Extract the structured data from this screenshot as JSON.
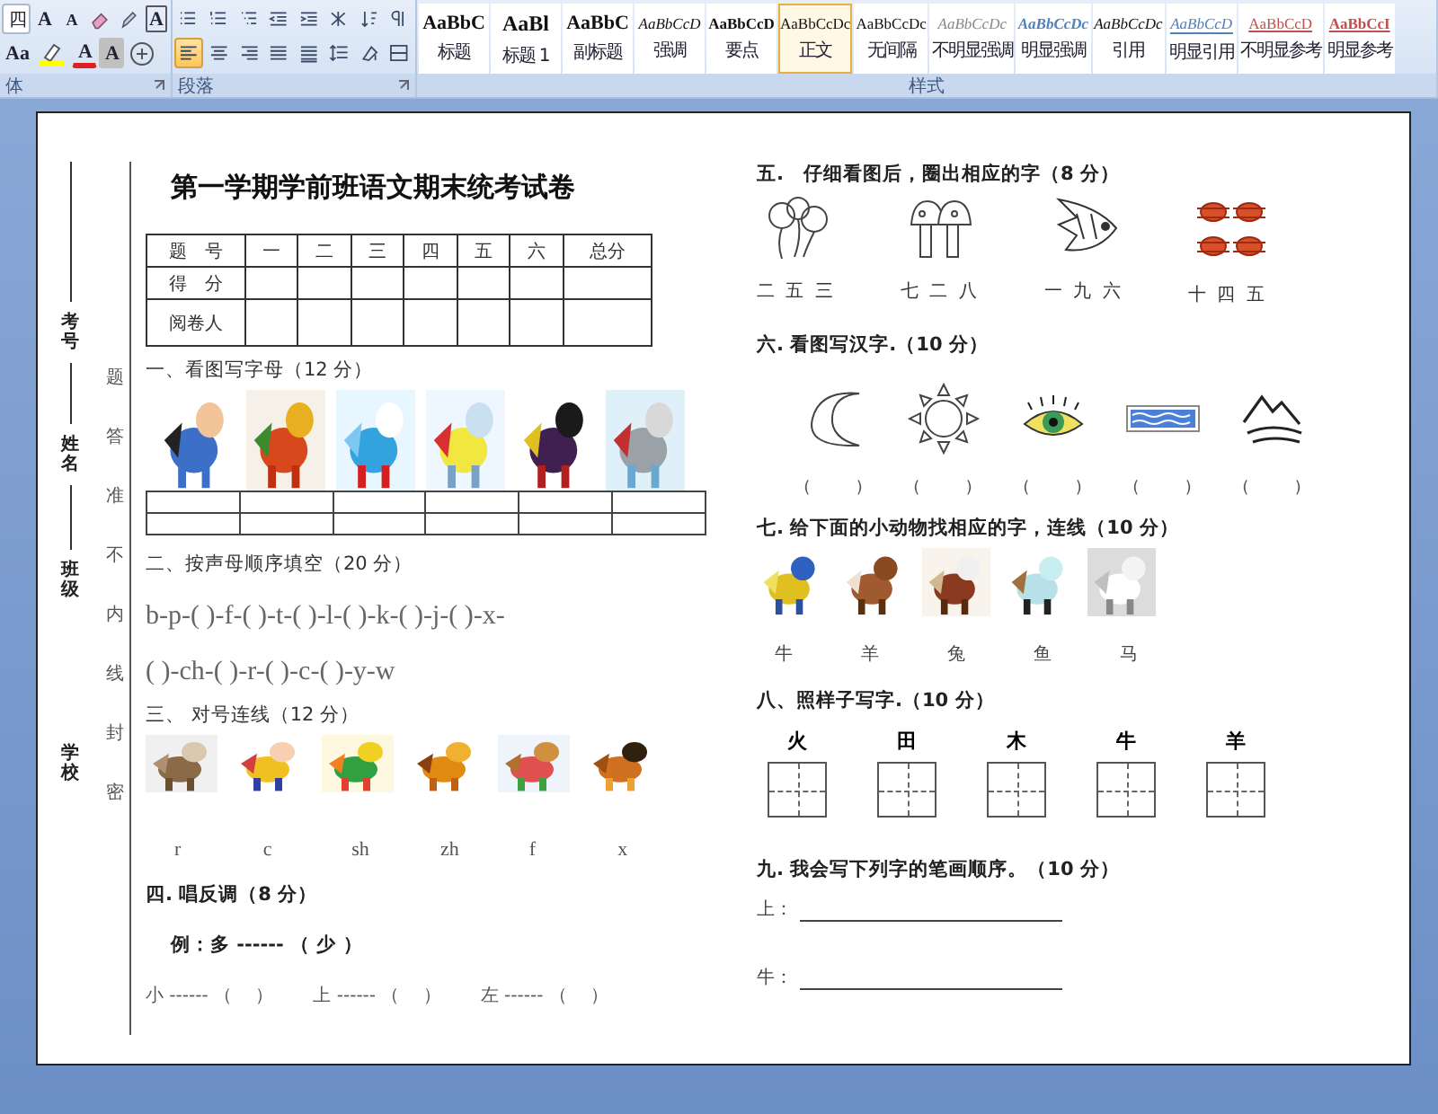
{
  "ribbon": {
    "font_group": {
      "label": "体",
      "top_tools": [
        {
          "kind": "size_field",
          "label": "四"
        },
        {
          "kind": "grow",
          "label": "A"
        },
        {
          "kind": "shrink",
          "label": "A"
        },
        {
          "kind": "clear"
        },
        {
          "kind": "phonetic"
        },
        {
          "kind": "border_char",
          "label": "A"
        }
      ],
      "bottom_tools": [
        {
          "kind": "case",
          "label": "Aa"
        },
        {
          "kind": "highlight"
        },
        {
          "kind": "font_color",
          "label": "A"
        },
        {
          "kind": "shading_char",
          "label": "A"
        },
        {
          "kind": "enclose"
        }
      ]
    },
    "paragraph_group": {
      "label": "段落",
      "top_tools": [
        {
          "kind": "bullets"
        },
        {
          "kind": "numbering"
        },
        {
          "kind": "multilevel"
        },
        {
          "kind": "outdent"
        },
        {
          "kind": "indent"
        },
        {
          "kind": "asian_layout"
        },
        {
          "kind": "sort"
        },
        {
          "kind": "marks"
        }
      ],
      "alignments": [
        {
          "kind": "left",
          "selected": true
        },
        {
          "kind": "center",
          "selected": false
        },
        {
          "kind": "right",
          "selected": false
        },
        {
          "kind": "justify",
          "selected": false
        },
        {
          "kind": "distributed",
          "selected": false
        }
      ],
      "bottom_tools": [
        {
          "kind": "line_spacing"
        },
        {
          "kind": "shading"
        },
        {
          "kind": "borders"
        }
      ]
    },
    "styles_group": {
      "label": "样式",
      "styles": [
        {
          "sample": "AaBbC",
          "name": "标题",
          "kind": "title",
          "selected": false
        },
        {
          "sample": "AaBl",
          "name": "标题 1",
          "kind": "heading",
          "selected": false
        },
        {
          "sample": "AaBbC",
          "name": "副标题",
          "kind": "title",
          "selected": false
        },
        {
          "sample": "AaBbCcD",
          "name": "强调",
          "kind": "emphasis",
          "selected": false
        },
        {
          "sample": "AaBbCcD",
          "name": "要点",
          "kind": "strong",
          "selected": false
        },
        {
          "sample": "AaBbCcDc",
          "name": "正文",
          "kind": "normal",
          "selected": true
        },
        {
          "sample": "AaBbCcDc",
          "name": "无间隔",
          "kind": "normal",
          "selected": false
        },
        {
          "sample": "AaBbCcDc",
          "name": "不明显强调",
          "kind": "subtle",
          "selected": false
        },
        {
          "sample": "AaBbCcDc",
          "name": "明显强调",
          "kind": "intense",
          "selected": false
        },
        {
          "sample": "AaBbCcDc",
          "name": "引用",
          "kind": "emphasis",
          "selected": false
        },
        {
          "sample": "AaBbCcD",
          "name": "明显引用",
          "kind": "intense_quote",
          "selected": false
        },
        {
          "sample": "AaBbCcD",
          "name": "不明显参考",
          "kind": "reference",
          "selected": false
        },
        {
          "sample": "AaBbCcI",
          "name": "明显参考",
          "kind": "intense_reference",
          "selected": false
        }
      ]
    }
  },
  "document": {
    "binding": {
      "fields": [
        "考号",
        "姓名",
        "班级",
        "学校"
      ],
      "seal_text": "题答准不内线封密"
    },
    "title": "第一学期学前班语文期末统考试卷",
    "score_table": {
      "header": [
        "题　号",
        "一",
        "二",
        "三",
        "四",
        "五",
        "六",
        "总分"
      ],
      "row_labels": [
        "得　分",
        "阅卷人"
      ]
    },
    "left_sections": [
      {
        "kind": "picture_letters",
        "heading": "一、看图写字母（12 分）"
      },
      {
        "kind": "fill_sequence",
        "heading": "二、按声母顺序填空（20 分）",
        "lines": [
          "b-p-( )-f-( )-t-( )-l-( )-k-( )-j-( )-x-",
          "( )-ch-( )-r-( )-c-( )-y-w"
        ]
      },
      {
        "kind": "match_letters",
        "heading": "三、 对号连线（12 分）",
        "letters": [
          "r",
          "c",
          "sh",
          "zh",
          "f",
          "x"
        ]
      },
      {
        "kind": "antonyms",
        "heading": "四. 唱反调（8 分）",
        "example": "例：多 ------ （ 少 ）",
        "items": [
          "小 ------ （　 ）",
          "上 ------ （　 ）",
          "左 ------ （　 ）"
        ]
      }
    ],
    "right_sections": [
      {
        "kind": "circle_chars",
        "heading": "五.　仔细看图后，圈出相应的字（8 分）",
        "items": [
          "二 五 三",
          "七 二 八",
          "一 九 六",
          "十 四 五"
        ]
      },
      {
        "kind": "write_chars",
        "heading": "六. 看图写汉字.（10 分）",
        "blanks": [
          "(         )",
          "(         )",
          "(         )",
          "(         )",
          "(         )"
        ]
      },
      {
        "kind": "match_chars",
        "heading": "七. 给下面的小动物找相应的字，连线（10 分）",
        "chars": [
          "牛",
          "羊",
          "兔",
          "鱼",
          "马"
        ]
      },
      {
        "kind": "copy_chars",
        "heading": "八、照样子写字.（10 分）",
        "chars": [
          "火",
          "田",
          "木",
          "牛",
          "羊"
        ]
      },
      {
        "kind": "stroke_order",
        "heading": "九. 我会写下列字的笔画顺序。（10 分）",
        "lines": [
          "上：",
          "牛："
        ]
      }
    ]
  }
}
